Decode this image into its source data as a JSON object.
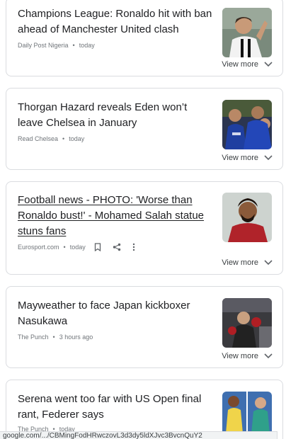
{
  "articles": [
    {
      "title": "Champions League: Ronaldo hit with ban ahead of Manchester United clash",
      "source": "Daily Post Nigeria",
      "time": "today",
      "view_more": "View more",
      "thumb": "ronaldo-photo"
    },
    {
      "title": "Thorgan Hazard reveals Eden won’t leave Chelsea in January",
      "source": "Read Chelsea",
      "time": "today",
      "view_more": "View more",
      "thumb": "chelsea-players-photo"
    },
    {
      "title": "Football news - PHOTO: 'Worse than Ronaldo bust!' - Mohamed Salah statue stuns fans",
      "source": "Eurosport.com",
      "time": "today",
      "view_more": "View more",
      "thumb": "salah-photo"
    },
    {
      "title": "Mayweather to face Japan kickboxer Nasukawa",
      "source": "The Punch",
      "time": "3 hours ago",
      "view_more": "View more",
      "thumb": "boxing-photo"
    },
    {
      "title": "Serena went too far with US Open final rant, Federer says",
      "source": "The Punch",
      "time": "today",
      "thumb": "tennis-photo"
    }
  ],
  "status_url": "google.com/.../CBMingFodHRwczovL3d3dy5ldXJvc3BvcnQuY2",
  "colors": {
    "text": "#202124",
    "meta": "#70757a",
    "border": "#dadce0"
  }
}
